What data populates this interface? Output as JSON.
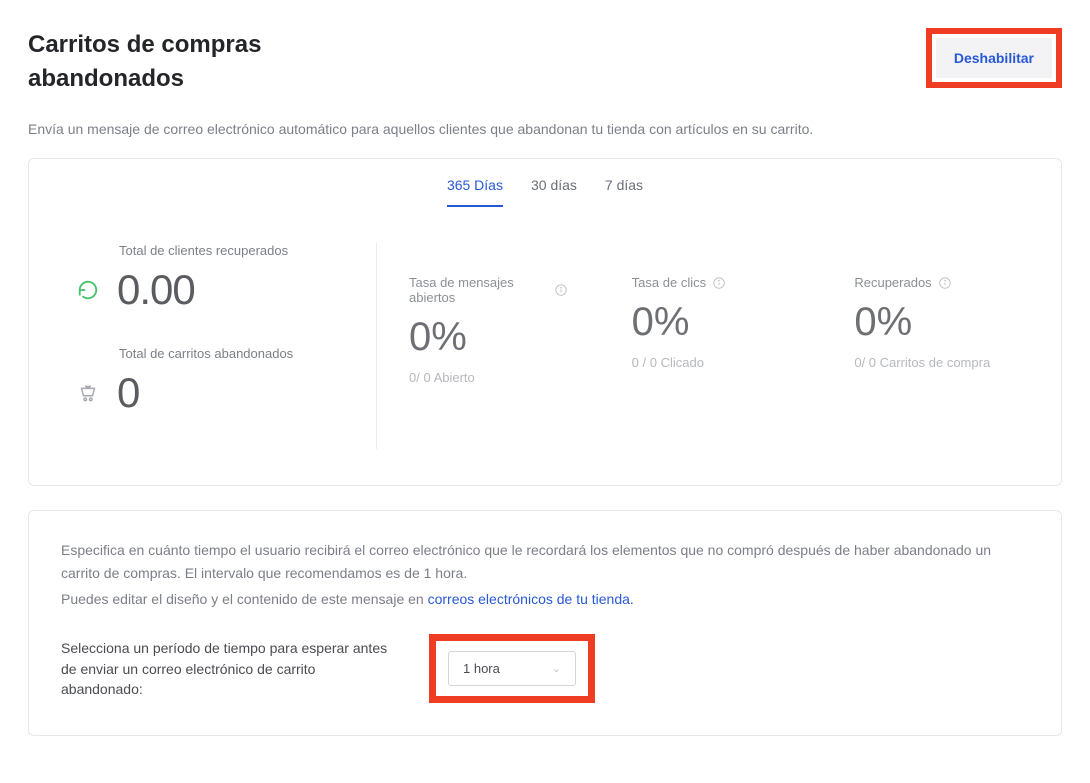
{
  "header": {
    "title": "Carritos de compras abandonados",
    "disable_label": "Deshabilitar"
  },
  "description": "Envía un mensaje de correo electrónico automático para aquellos clientes que abandonan tu tienda con artículos en su carrito.",
  "tabs": [
    {
      "label": "365 Días",
      "active": true
    },
    {
      "label": "30 días",
      "active": false
    },
    {
      "label": "7 días",
      "active": false
    }
  ],
  "left_stats": {
    "recovered_label": "Total de clientes recuperados",
    "recovered_value": "0.00",
    "abandoned_label": "Total de carritos abandonados",
    "abandoned_value": "0"
  },
  "metrics": [
    {
      "title": "Tasa de mensajes abiertos",
      "value": "0%",
      "sub": "0/ 0 Abierto"
    },
    {
      "title": "Tasa de clics",
      "value": "0%",
      "sub": "0 / 0 Clicado"
    },
    {
      "title": "Recuperados",
      "value": "0%",
      "sub": "0/ 0 Carritos de compra"
    }
  ],
  "config": {
    "para1": "Especifica en cuánto tiempo el usuario recibirá el correo electrónico que le recordará los elementos que no compró después de haber abandonado un carrito de compras. El intervalo que recomendamos es de 1 hora.",
    "para2_pre": "Puedes editar el diseño y el contenido de este mensaje en ",
    "para2_link": "correos electrónicos de tu tienda.",
    "selector_label": "Selecciona un período de tiempo para esperar antes de enviar un correo electrónico de carrito abandonado:",
    "selector_value": "1 hora"
  }
}
